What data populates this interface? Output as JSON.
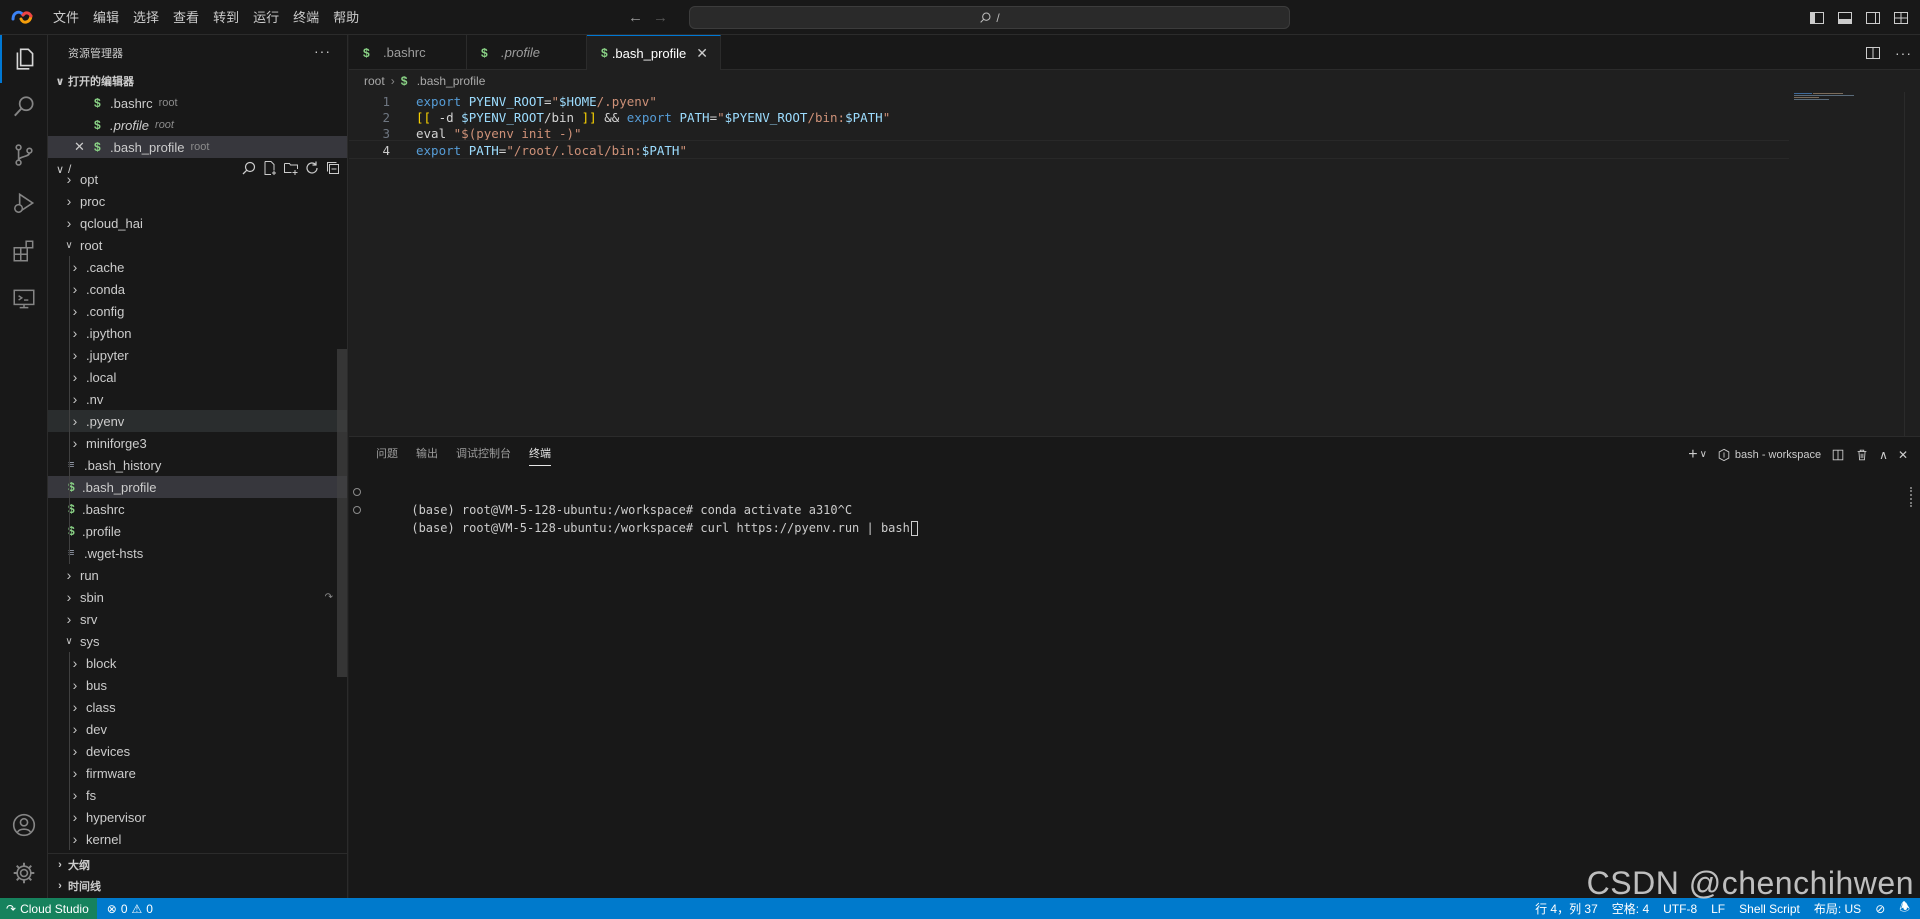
{
  "titlebar": {
    "menus": [
      "文件",
      "编辑",
      "选择",
      "查看",
      "转到",
      "运行",
      "终端",
      "帮助"
    ],
    "command_center": "/"
  },
  "sidebar": {
    "title": "资源管理器",
    "open_editors": {
      "title": "打开的编辑器",
      "items": [
        {
          "name": ".bashrc",
          "desc": "root"
        },
        {
          "name": ".profile",
          "desc": "root"
        },
        {
          "name": ".bash_profile",
          "desc": "root"
        }
      ]
    },
    "root_label": "/",
    "tree": [
      {
        "label": "opt",
        "type": "folder",
        "depth": 0
      },
      {
        "label": "proc",
        "type": "folder",
        "depth": 0
      },
      {
        "label": "qcloud_hai",
        "type": "folder",
        "depth": 0
      },
      {
        "label": "root",
        "type": "folder-open",
        "depth": 0
      },
      {
        "label": ".cache",
        "type": "folder",
        "depth": 1
      },
      {
        "label": ".conda",
        "type": "folder",
        "depth": 1
      },
      {
        "label": ".config",
        "type": "folder",
        "depth": 1
      },
      {
        "label": ".ipython",
        "type": "folder",
        "depth": 1
      },
      {
        "label": ".jupyter",
        "type": "folder",
        "depth": 1
      },
      {
        "label": ".local",
        "type": "folder",
        "depth": 1
      },
      {
        "label": ".nv",
        "type": "folder",
        "depth": 1
      },
      {
        "label": ".pyenv",
        "type": "folder",
        "depth": 1
      },
      {
        "label": "miniforge3",
        "type": "folder",
        "depth": 1
      },
      {
        "label": ".bash_history",
        "type": "lines",
        "depth": 1
      },
      {
        "label": ".bash_profile",
        "type": "shell",
        "depth": 1
      },
      {
        "label": ".bashrc",
        "type": "shell",
        "depth": 1
      },
      {
        "label": ".profile",
        "type": "shell",
        "depth": 1
      },
      {
        "label": ".wget-hsts",
        "type": "lines",
        "depth": 1
      },
      {
        "label": "run",
        "type": "folder",
        "depth": 0
      },
      {
        "label": "sbin",
        "type": "folder",
        "depth": 0
      },
      {
        "label": "srv",
        "type": "folder",
        "depth": 0
      },
      {
        "label": "sys",
        "type": "folder-open",
        "depth": 0
      },
      {
        "label": "block",
        "type": "folder",
        "depth": 1
      },
      {
        "label": "bus",
        "type": "folder",
        "depth": 1
      },
      {
        "label": "class",
        "type": "folder",
        "depth": 1
      },
      {
        "label": "dev",
        "type": "folder",
        "depth": 1
      },
      {
        "label": "devices",
        "type": "folder",
        "depth": 1
      },
      {
        "label": "firmware",
        "type": "folder",
        "depth": 1
      },
      {
        "label": "fs",
        "type": "folder",
        "depth": 1
      },
      {
        "label": "hypervisor",
        "type": "folder",
        "depth": 1
      },
      {
        "label": "kernel",
        "type": "folder",
        "depth": 1
      }
    ],
    "outline_title": "大纲",
    "timeline_title": "时间线"
  },
  "tabs": [
    {
      "label": ".bashrc"
    },
    {
      "label": ".profile"
    },
    {
      "label": ".bash_profile"
    }
  ],
  "breadcrumb": {
    "parts": [
      "root",
      ".bash_profile"
    ]
  },
  "editor": {
    "line_numbers": [
      "1",
      "2",
      "3",
      "4"
    ],
    "lines": [
      [
        [
          "kw",
          "export"
        ],
        [
          "plain",
          " "
        ],
        [
          "var",
          "PYENV_ROOT"
        ],
        [
          "op",
          "="
        ],
        [
          "str",
          "\""
        ],
        [
          "var",
          "$HOME"
        ],
        [
          "str",
          "/.pyenv\""
        ]
      ],
      [
        [
          "br",
          "[["
        ],
        [
          "plain",
          " -d "
        ],
        [
          "var",
          "$PYENV_ROOT"
        ],
        [
          "plain",
          "/bin "
        ],
        [
          "br",
          "]]"
        ],
        [
          "plain",
          " && "
        ],
        [
          "kw",
          "export"
        ],
        [
          "plain",
          " "
        ],
        [
          "var",
          "PATH"
        ],
        [
          "op",
          "="
        ],
        [
          "str",
          "\""
        ],
        [
          "var",
          "$PYENV_ROOT"
        ],
        [
          "str",
          "/bin:"
        ],
        [
          "var",
          "$PATH"
        ],
        [
          "str",
          "\""
        ]
      ],
      [
        [
          "plain",
          "eval "
        ],
        [
          "str",
          "\"$(pyenv init -)\""
        ]
      ],
      [
        [
          "kw",
          "export"
        ],
        [
          "plain",
          " "
        ],
        [
          "var",
          "PATH"
        ],
        [
          "op",
          "="
        ],
        [
          "str",
          "\"/root/.local/bin:"
        ],
        [
          "var",
          "$PATH"
        ],
        [
          "str",
          "\""
        ]
      ]
    ]
  },
  "panel": {
    "tabs": [
      "问题",
      "输出",
      "调试控制台",
      "终端"
    ],
    "terminal_name": "bash - workspace",
    "lines": [
      "(base) root@VM-5-128-ubuntu:/workspace# conda activate a310^C",
      "(base) root@VM-5-128-ubuntu:/workspace# curl https://pyenv.run | bash"
    ]
  },
  "statusbar": {
    "remote": "Cloud Studio",
    "errors": "0",
    "warnings": "0",
    "position": "行 4，列 37",
    "spaces": "空格: 4",
    "encoding": "UTF-8",
    "eol": "LF",
    "language": "Shell Script",
    "layout": "布局: US"
  },
  "watermark": "CSDN @chenchihwen",
  "colors": {
    "accent": "#007acc",
    "remote": "#16825d",
    "shell": "#89d185"
  }
}
